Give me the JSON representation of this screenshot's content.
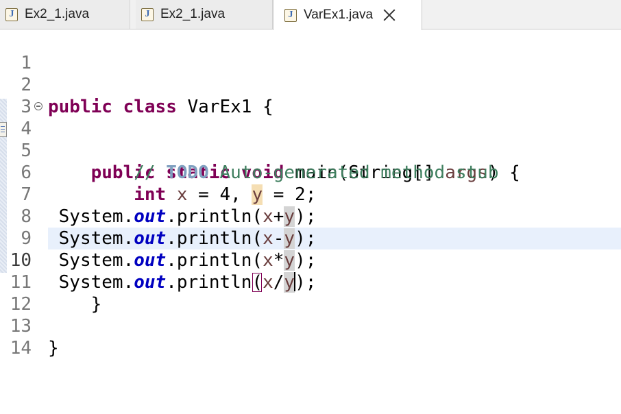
{
  "tabs": [
    {
      "label": "Ex2_1.java",
      "icon": "java-file-icon",
      "active": false
    },
    {
      "label": "Ex2_1.java",
      "icon": "java-file-icon",
      "active": false
    },
    {
      "label": "VarEx1.java",
      "icon": "java-file-icon",
      "active": true
    }
  ],
  "editor": {
    "current_line": "10",
    "lines": [
      {
        "num": "1"
      },
      {
        "num": "2",
        "kw1": "public",
        "kw2": "class",
        "name": "VarEx1",
        "brace": "{"
      },
      {
        "num": "3"
      },
      {
        "num": "4",
        "kw1": "public",
        "kw2": "static",
        "kw3": "void",
        "method": "main(String[]",
        "param": "args",
        "rest": ") {"
      },
      {
        "num": "5",
        "comment_start": "// ",
        "todo": "TODO",
        "comment_rest": " Auto-generated method stub"
      },
      {
        "num": "6",
        "kw": "int",
        "x": "x",
        "eq1": " = 4, ",
        "y": "y",
        "eq2": " = 2;"
      },
      {
        "num": "7",
        "obj": "System.",
        "field": "out",
        "call": ".println(",
        "x": "x",
        "op": "+",
        "y": "y",
        "end": ");"
      },
      {
        "num": "8",
        "obj": "System.",
        "field": "out",
        "call": ".println(",
        "x": "x",
        "op": "-",
        "y": "y",
        "end": ");"
      },
      {
        "num": "9",
        "obj": "System.",
        "field": "out",
        "call": ".println(",
        "x": "x",
        "op": "*",
        "y": "y",
        "end": ");"
      },
      {
        "num": "10",
        "obj": "System.",
        "field": "out",
        "call": ".println",
        "open": "(",
        "x": "x",
        "op": "/",
        "y": "y",
        "end": ");"
      },
      {
        "num": "11",
        "brace": "}"
      },
      {
        "num": "12"
      },
      {
        "num": "13",
        "brace": "}"
      },
      {
        "num": "14"
      }
    ]
  },
  "colors": {
    "keyword": "#7f0055",
    "comment": "#3f7f5f",
    "todo": "#7f9fbf",
    "field": "#0000c0",
    "variable": "#6a3e3e",
    "current_line": "#e8f0fc"
  }
}
